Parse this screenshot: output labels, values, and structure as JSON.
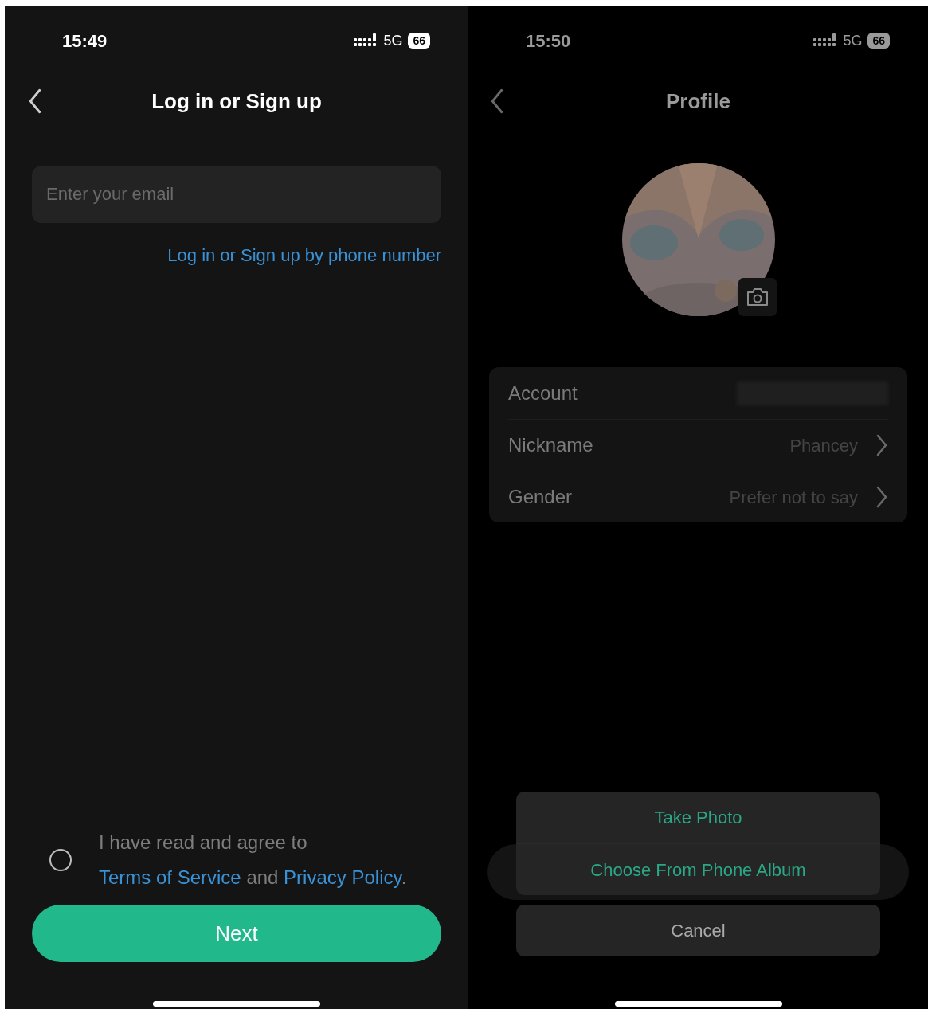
{
  "login_screen": {
    "status_bar": {
      "time": "15:49",
      "network": "5G",
      "battery": "66"
    },
    "title": "Log in or Sign up",
    "email_field": {
      "placeholder": "Enter your email"
    },
    "phone_link": "Log in or Sign up by phone number",
    "agreement": {
      "checked": false,
      "parts": [
        {
          "kind": "plain",
          "text": "I have read and agree to"
        },
        {
          "kind": "link",
          "text": "Terms of Service"
        },
        {
          "kind": "plain",
          "text": "and"
        },
        {
          "kind": "link",
          "text": "Privacy Policy"
        },
        {
          "kind": "plain",
          "text": "."
        }
      ]
    },
    "next_button": "Next"
  },
  "profile_screen": {
    "status_bar": {
      "time": "15:50",
      "network": "5G",
      "battery": "66"
    },
    "title": "Profile",
    "rows": [
      {
        "label": "Account",
        "kind": "hidden"
      },
      {
        "label": "Nickname",
        "value": "Phancey",
        "kind": "link"
      },
      {
        "label": "Gender",
        "value": "Prefer not to say",
        "kind": "link"
      }
    ],
    "action_sheet": {
      "options": [
        "Take Photo",
        "Choose From Phone Album"
      ],
      "cancel": "Cancel"
    }
  }
}
